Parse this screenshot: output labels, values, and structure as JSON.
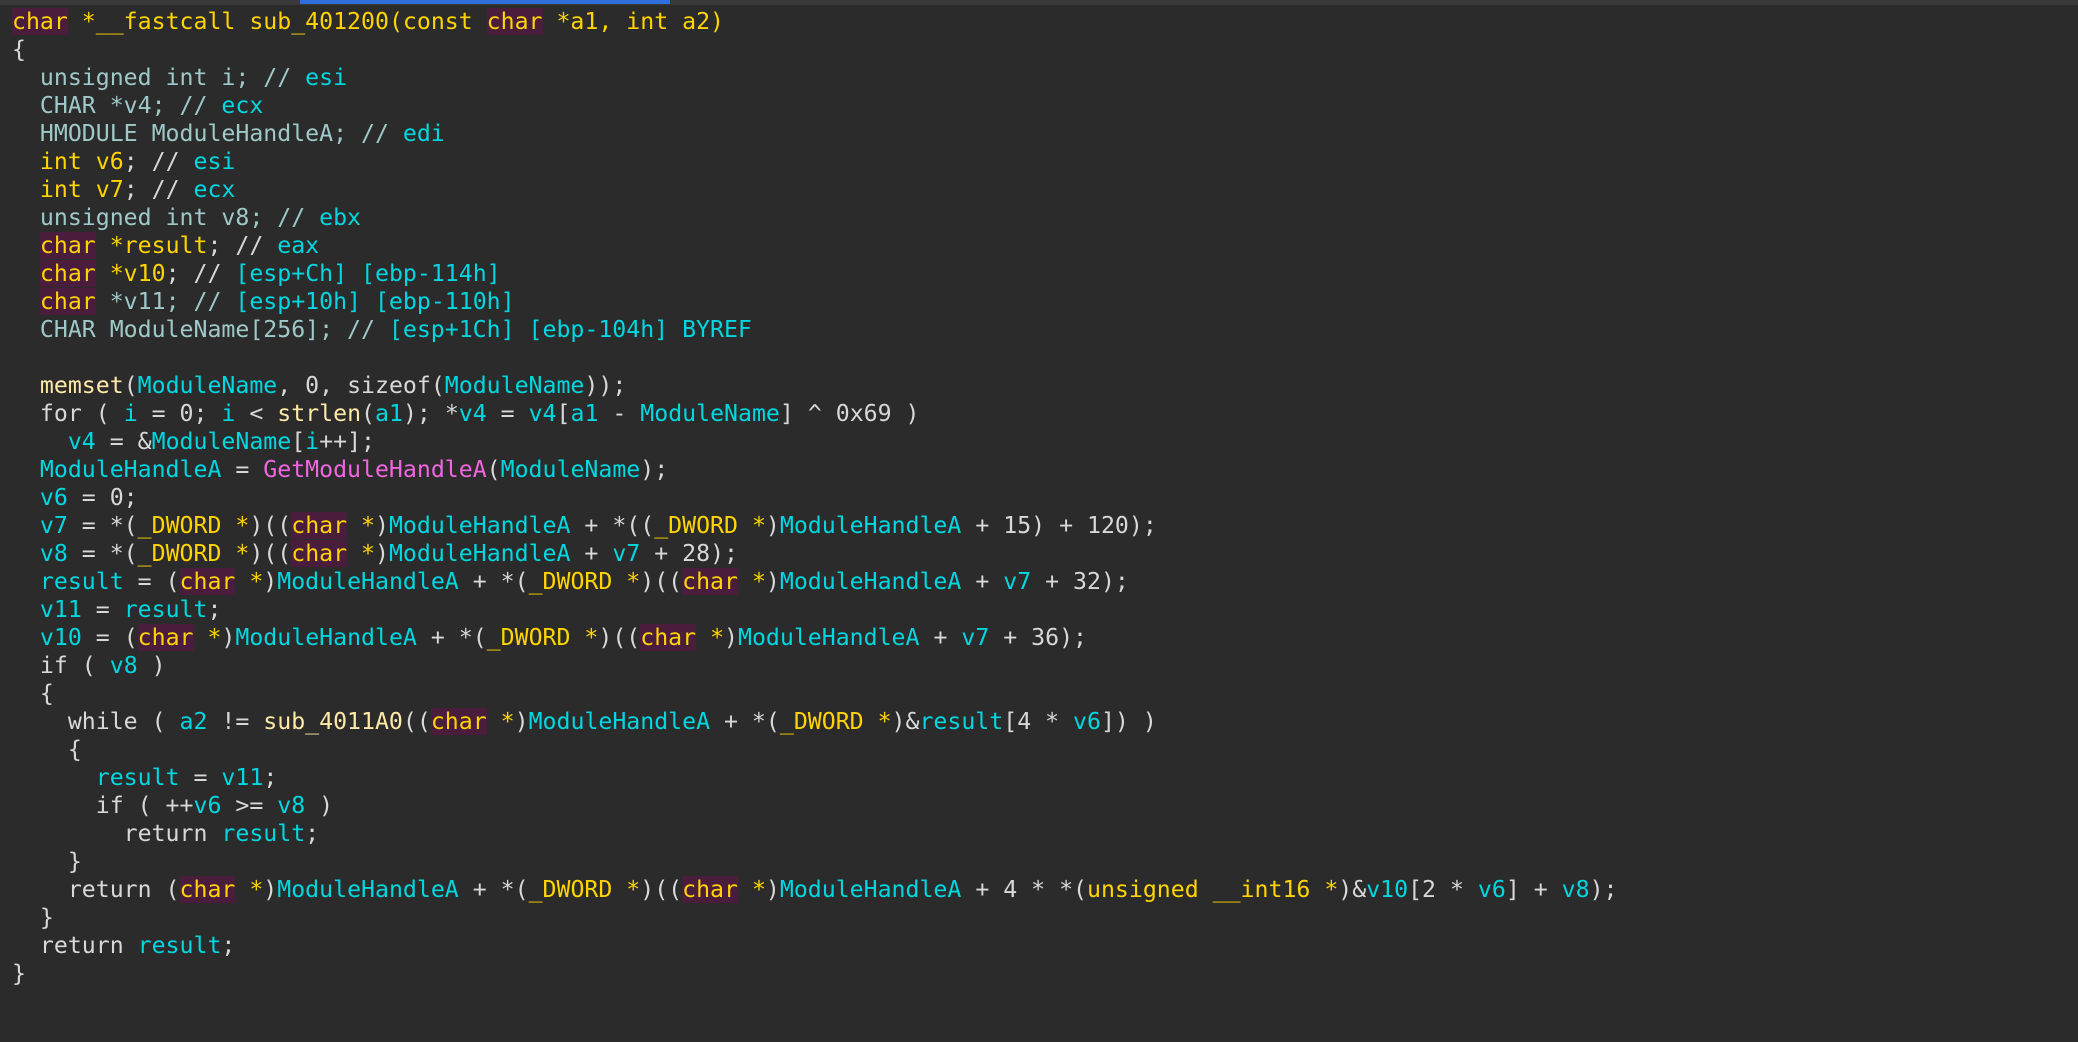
{
  "editor": {
    "lines": [
      [
        {
          "t": "char",
          "c": "kwh"
        },
        {
          "t": " *__fastcall ",
          "c": "kw"
        },
        {
          "t": "sub_401200",
          "c": "kw"
        },
        {
          "t": "(const ",
          "c": "kw"
        },
        {
          "t": "char",
          "c": "kwh"
        },
        {
          "t": " *a1, ",
          "c": "kw"
        },
        {
          "t": "int",
          "c": "kw"
        },
        {
          "t": " a2)",
          "c": "kw"
        }
      ],
      [
        {
          "t": "{",
          "c": "op"
        }
      ],
      [
        {
          "t": "  unsigned int i; // ",
          "c": "type"
        },
        {
          "t": "esi",
          "c": "reg"
        }
      ],
      [
        {
          "t": "  CHAR *v4; // ",
          "c": "type"
        },
        {
          "t": "ecx",
          "c": "reg"
        }
      ],
      [
        {
          "t": "  HMODULE ModuleHandleA; // ",
          "c": "type"
        },
        {
          "t": "edi",
          "c": "reg"
        }
      ],
      [
        {
          "t": "  int",
          "c": "kw"
        },
        {
          "t": " v6",
          "c": "kw"
        },
        {
          "t": "; // ",
          "c": "op"
        },
        {
          "t": "esi",
          "c": "reg"
        }
      ],
      [
        {
          "t": "  int",
          "c": "kw"
        },
        {
          "t": " v7",
          "c": "kw"
        },
        {
          "t": "; // ",
          "c": "op"
        },
        {
          "t": "ecx",
          "c": "reg"
        }
      ],
      [
        {
          "t": "  unsigned int v8; // ",
          "c": "type"
        },
        {
          "t": "ebx",
          "c": "reg"
        }
      ],
      [
        {
          "t": "  ",
          "c": "op"
        },
        {
          "t": "char",
          "c": "kwh"
        },
        {
          "t": " *result",
          "c": "kw"
        },
        {
          "t": "; // ",
          "c": "op"
        },
        {
          "t": "eax",
          "c": "reg"
        }
      ],
      [
        {
          "t": "  ",
          "c": "op"
        },
        {
          "t": "char",
          "c": "kwh"
        },
        {
          "t": " *v10",
          "c": "kw"
        },
        {
          "t": "; // ",
          "c": "op"
        },
        {
          "t": "[esp+Ch] [ebp-114h]",
          "c": "reg"
        }
      ],
      [
        {
          "t": "  ",
          "c": "op"
        },
        {
          "t": "char",
          "c": "kwh"
        },
        {
          "t": " *v11; // ",
          "c": "type"
        },
        {
          "t": "[esp+10h] [ebp-110h]",
          "c": "reg"
        }
      ],
      [
        {
          "t": "  CHAR ModuleName[256]; // ",
          "c": "type"
        },
        {
          "t": "[esp+1Ch] [ebp-104h] BYREF",
          "c": "reg"
        }
      ],
      [
        {
          "t": "",
          "c": "op"
        }
      ],
      [
        {
          "t": "  ",
          "c": "op"
        },
        {
          "t": "memset",
          "c": "fn"
        },
        {
          "t": "(",
          "c": "op"
        },
        {
          "t": "ModuleName",
          "c": "name"
        },
        {
          "t": ", 0, sizeof(",
          "c": "op"
        },
        {
          "t": "ModuleName",
          "c": "name"
        },
        {
          "t": "));",
          "c": "op"
        }
      ],
      [
        {
          "t": "  for ( ",
          "c": "op"
        },
        {
          "t": "i",
          "c": "name"
        },
        {
          "t": " = 0; ",
          "c": "op"
        },
        {
          "t": "i",
          "c": "name"
        },
        {
          "t": " < ",
          "c": "op"
        },
        {
          "t": "strlen",
          "c": "fn"
        },
        {
          "t": "(",
          "c": "op"
        },
        {
          "t": "a1",
          "c": "name"
        },
        {
          "t": "); *",
          "c": "op"
        },
        {
          "t": "v4",
          "c": "name"
        },
        {
          "t": " = ",
          "c": "op"
        },
        {
          "t": "v4",
          "c": "name"
        },
        {
          "t": "[",
          "c": "op"
        },
        {
          "t": "a1",
          "c": "name"
        },
        {
          "t": " - ",
          "c": "op"
        },
        {
          "t": "ModuleName",
          "c": "name"
        },
        {
          "t": "] ^ 0x69 )",
          "c": "op"
        }
      ],
      [
        {
          "t": "    ",
          "c": "op"
        },
        {
          "t": "v4",
          "c": "name"
        },
        {
          "t": " = &",
          "c": "op"
        },
        {
          "t": "ModuleName",
          "c": "name"
        },
        {
          "t": "[",
          "c": "op"
        },
        {
          "t": "i",
          "c": "name"
        },
        {
          "t": "++];",
          "c": "op"
        }
      ],
      [
        {
          "t": "  ",
          "c": "op"
        },
        {
          "t": "ModuleHandleA",
          "c": "name"
        },
        {
          "t": " = ",
          "c": "op"
        },
        {
          "t": "GetModuleHandleA",
          "c": "api"
        },
        {
          "t": "(",
          "c": "op"
        },
        {
          "t": "ModuleName",
          "c": "name"
        },
        {
          "t": ");",
          "c": "op"
        }
      ],
      [
        {
          "t": "  ",
          "c": "op"
        },
        {
          "t": "v6",
          "c": "name"
        },
        {
          "t": " = 0;",
          "c": "op"
        }
      ],
      [
        {
          "t": "  ",
          "c": "op"
        },
        {
          "t": "v7",
          "c": "name"
        },
        {
          "t": " = *(",
          "c": "op"
        },
        {
          "t": "_DWORD *",
          "c": "kw"
        },
        {
          "t": ")((",
          "c": "op"
        },
        {
          "t": "char",
          "c": "kwh"
        },
        {
          "t": " *",
          "c": "kw"
        },
        {
          "t": ")",
          "c": "op"
        },
        {
          "t": "ModuleHandleA",
          "c": "name"
        },
        {
          "t": " + *((",
          "c": "op"
        },
        {
          "t": "_DWORD *",
          "c": "kw"
        },
        {
          "t": ")",
          "c": "op"
        },
        {
          "t": "ModuleHandleA",
          "c": "name"
        },
        {
          "t": " + 15) + 120);",
          "c": "op"
        }
      ],
      [
        {
          "t": "  ",
          "c": "op"
        },
        {
          "t": "v8",
          "c": "name"
        },
        {
          "t": " = *(",
          "c": "op"
        },
        {
          "t": "_DWORD *",
          "c": "kw"
        },
        {
          "t": ")((",
          "c": "op"
        },
        {
          "t": "char",
          "c": "kwh"
        },
        {
          "t": " *",
          "c": "kw"
        },
        {
          "t": ")",
          "c": "op"
        },
        {
          "t": "ModuleHandleA",
          "c": "name"
        },
        {
          "t": " + ",
          "c": "op"
        },
        {
          "t": "v7",
          "c": "name"
        },
        {
          "t": " + 28);",
          "c": "op"
        }
      ],
      [
        {
          "t": "  ",
          "c": "op"
        },
        {
          "t": "result",
          "c": "name"
        },
        {
          "t": " = (",
          "c": "op"
        },
        {
          "t": "char",
          "c": "kwh"
        },
        {
          "t": " *",
          "c": "kw"
        },
        {
          "t": ")",
          "c": "op"
        },
        {
          "t": "ModuleHandleA",
          "c": "name"
        },
        {
          "t": " + *(",
          "c": "op"
        },
        {
          "t": "_DWORD *",
          "c": "kw"
        },
        {
          "t": ")((",
          "c": "op"
        },
        {
          "t": "char",
          "c": "kwh"
        },
        {
          "t": " *",
          "c": "kw"
        },
        {
          "t": ")",
          "c": "op"
        },
        {
          "t": "ModuleHandleA",
          "c": "name"
        },
        {
          "t": " + ",
          "c": "op"
        },
        {
          "t": "v7",
          "c": "name"
        },
        {
          "t": " + 32);",
          "c": "op"
        }
      ],
      [
        {
          "t": "  ",
          "c": "op"
        },
        {
          "t": "v11",
          "c": "name"
        },
        {
          "t": " = ",
          "c": "op"
        },
        {
          "t": "result",
          "c": "name"
        },
        {
          "t": ";",
          "c": "op"
        }
      ],
      [
        {
          "t": "  ",
          "c": "op"
        },
        {
          "t": "v10",
          "c": "name"
        },
        {
          "t": " = (",
          "c": "op"
        },
        {
          "t": "char",
          "c": "kwh"
        },
        {
          "t": " *",
          "c": "kw"
        },
        {
          "t": ")",
          "c": "op"
        },
        {
          "t": "ModuleHandleA",
          "c": "name"
        },
        {
          "t": " + *(",
          "c": "op"
        },
        {
          "t": "_DWORD *",
          "c": "kw"
        },
        {
          "t": ")((",
          "c": "op"
        },
        {
          "t": "char",
          "c": "kwh"
        },
        {
          "t": " *",
          "c": "kw"
        },
        {
          "t": ")",
          "c": "op"
        },
        {
          "t": "ModuleHandleA",
          "c": "name"
        },
        {
          "t": " + ",
          "c": "op"
        },
        {
          "t": "v7",
          "c": "name"
        },
        {
          "t": " + 36);",
          "c": "op"
        }
      ],
      [
        {
          "t": "  if ( ",
          "c": "op"
        },
        {
          "t": "v8",
          "c": "name"
        },
        {
          "t": " )",
          "c": "op"
        }
      ],
      [
        {
          "t": "  {",
          "c": "op"
        }
      ],
      [
        {
          "t": "    while ( ",
          "c": "op"
        },
        {
          "t": "a2",
          "c": "name"
        },
        {
          "t": " != ",
          "c": "op"
        },
        {
          "t": "sub_4011A0",
          "c": "fn"
        },
        {
          "t": "((",
          "c": "op"
        },
        {
          "t": "char",
          "c": "kwh"
        },
        {
          "t": " *",
          "c": "kw"
        },
        {
          "t": ")",
          "c": "op"
        },
        {
          "t": "ModuleHandleA",
          "c": "name"
        },
        {
          "t": " + *(",
          "c": "op"
        },
        {
          "t": "_DWORD *",
          "c": "kw"
        },
        {
          "t": ")&",
          "c": "op"
        },
        {
          "t": "result",
          "c": "name"
        },
        {
          "t": "[4 * ",
          "c": "op"
        },
        {
          "t": "v6",
          "c": "name"
        },
        {
          "t": "]) )",
          "c": "op"
        }
      ],
      [
        {
          "t": "    {",
          "c": "op"
        }
      ],
      [
        {
          "t": "      ",
          "c": "op"
        },
        {
          "t": "result",
          "c": "name"
        },
        {
          "t": " = ",
          "c": "op"
        },
        {
          "t": "v11",
          "c": "name"
        },
        {
          "t": ";",
          "c": "op"
        }
      ],
      [
        {
          "t": "      if ( ++",
          "c": "op"
        },
        {
          "t": "v6",
          "c": "name"
        },
        {
          "t": " >= ",
          "c": "op"
        },
        {
          "t": "v8",
          "c": "name"
        },
        {
          "t": " )",
          "c": "op"
        }
      ],
      [
        {
          "t": "        return ",
          "c": "op"
        },
        {
          "t": "result",
          "c": "name"
        },
        {
          "t": ";",
          "c": "op"
        }
      ],
      [
        {
          "t": "    }",
          "c": "op"
        }
      ],
      [
        {
          "t": "    return (",
          "c": "op"
        },
        {
          "t": "char",
          "c": "kwh"
        },
        {
          "t": " *",
          "c": "kw"
        },
        {
          "t": ")",
          "c": "op"
        },
        {
          "t": "ModuleHandleA",
          "c": "name"
        },
        {
          "t": " + *(",
          "c": "op"
        },
        {
          "t": "_DWORD *",
          "c": "kw"
        },
        {
          "t": ")((",
          "c": "op"
        },
        {
          "t": "char",
          "c": "kwh"
        },
        {
          "t": " *",
          "c": "kw"
        },
        {
          "t": ")",
          "c": "op"
        },
        {
          "t": "ModuleHandleA",
          "c": "name"
        },
        {
          "t": " + 4 * *(",
          "c": "op"
        },
        {
          "t": "unsigned __int16 *",
          "c": "kw"
        },
        {
          "t": ")&",
          "c": "op"
        },
        {
          "t": "v10",
          "c": "name"
        },
        {
          "t": "[2 * ",
          "c": "op"
        },
        {
          "t": "v6",
          "c": "name"
        },
        {
          "t": "] + ",
          "c": "op"
        },
        {
          "t": "v8",
          "c": "name"
        },
        {
          "t": ");",
          "c": "op"
        }
      ],
      [
        {
          "t": "  }",
          "c": "op"
        }
      ],
      [
        {
          "t": "  return ",
          "c": "op"
        },
        {
          "t": "result",
          "c": "name"
        },
        {
          "t": ";",
          "c": "op"
        }
      ],
      [
        {
          "t": "}",
          "c": "op"
        }
      ]
    ]
  }
}
